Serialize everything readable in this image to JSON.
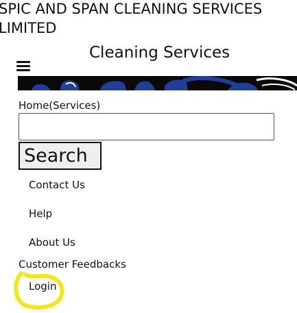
{
  "header": {
    "company_name": "SPIC AND SPAN CLEANING SERVICES LIMITED",
    "page_heading": "Cleaning Services"
  },
  "menu": {
    "icon": "hamburger-menu-icon"
  },
  "breadcrumb": {
    "text": "Home(Services)"
  },
  "search": {
    "value": "",
    "placeholder": "",
    "button_label": "Search"
  },
  "nav": {
    "contact": "Contact Us",
    "help": "Help",
    "about": "About Us",
    "feedback": "Customer Feedbacks",
    "login": "Login"
  },
  "colors": {
    "annotation_highlight": "#f5e61a",
    "banner_blue": "#1f3f9a"
  }
}
